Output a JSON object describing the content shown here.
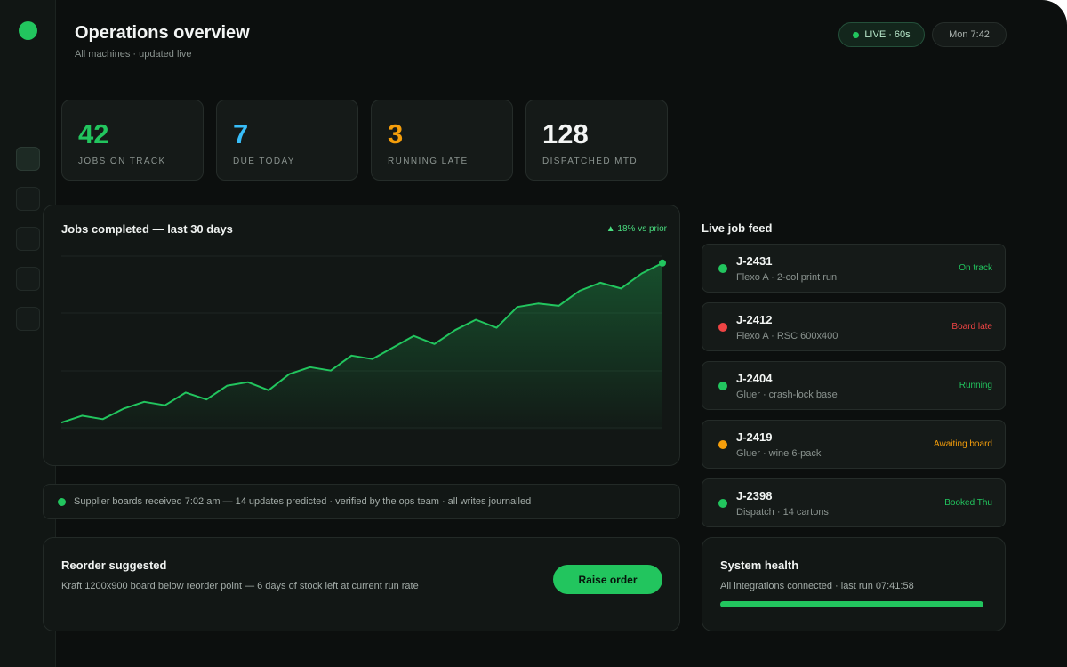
{
  "header": {
    "title": "Operations overview",
    "subtitle": "All machines · updated live",
    "live_label": "LIVE · 60s",
    "time_label": "Mon 7:42"
  },
  "stats": [
    {
      "value": "42",
      "label": "JOBS ON TRACK",
      "color": "#22c55e"
    },
    {
      "value": "7",
      "label": "DUE TODAY",
      "color": "#38bdf8"
    },
    {
      "value": "3",
      "label": "RUNNING LATE",
      "color": "#f59e0b"
    },
    {
      "value": "128",
      "label": "DISPATCHED MTD",
      "color": "#f3f5f4"
    }
  ],
  "chart": {
    "title": "Jobs completed — last 30 days",
    "delta": "▲ 18% vs prior"
  },
  "chart_data": {
    "type": "area",
    "title": "Jobs completed — last 30 days",
    "xlabel": "",
    "ylabel": "",
    "grid": true,
    "x": [
      1,
      2,
      3,
      4,
      5,
      6,
      7,
      8,
      9,
      10,
      11,
      12,
      13,
      14,
      15,
      16,
      17,
      18,
      19,
      20,
      21,
      22,
      23,
      24,
      25,
      26,
      27,
      28,
      29,
      30
    ],
    "values": [
      3,
      6,
      4.5,
      9,
      12,
      10.5,
      16,
      13,
      19,
      20.5,
      17,
      24,
      27,
      25.5,
      32,
      30.5,
      35.5,
      40.5,
      37,
      43,
      47.5,
      44,
      53,
      54.5,
      53.5,
      60,
      63.5,
      61,
      67.5,
      72
    ],
    "ylim": [
      0,
      75
    ],
    "color": "#22c55e"
  },
  "notice": {
    "text": "Supplier boards received 7:02 am — 14 updates predicted · verified by the ops team · all writes journalled"
  },
  "reorder": {
    "title": "Reorder suggested",
    "text": "Kraft 1200x900 board below reorder point — 6 days of stock left at current run rate",
    "button_label": "Raise order"
  },
  "feed": {
    "title": "Live job feed",
    "items": [
      {
        "id": "J-2431",
        "sub": "Flexo A · 2-col print run",
        "status": "On track",
        "color": "#22c55e"
      },
      {
        "id": "J-2412",
        "sub": "Flexo A · RSC 600x400",
        "status": "Board late",
        "color": "#ef4444"
      },
      {
        "id": "J-2404",
        "sub": "Gluer · crash-lock base",
        "status": "Running",
        "color": "#22c55e"
      },
      {
        "id": "J-2419",
        "sub": "Gluer · wine 6-pack",
        "status": "Awaiting board",
        "color": "#f59e0b"
      },
      {
        "id": "J-2398",
        "sub": "Dispatch · 14 cartons",
        "status": "Booked Thu",
        "color": "#22c55e"
      }
    ]
  },
  "health": {
    "title": "System health",
    "text": "All integrations connected · last run 07:41:58",
    "progress": 1.0
  }
}
